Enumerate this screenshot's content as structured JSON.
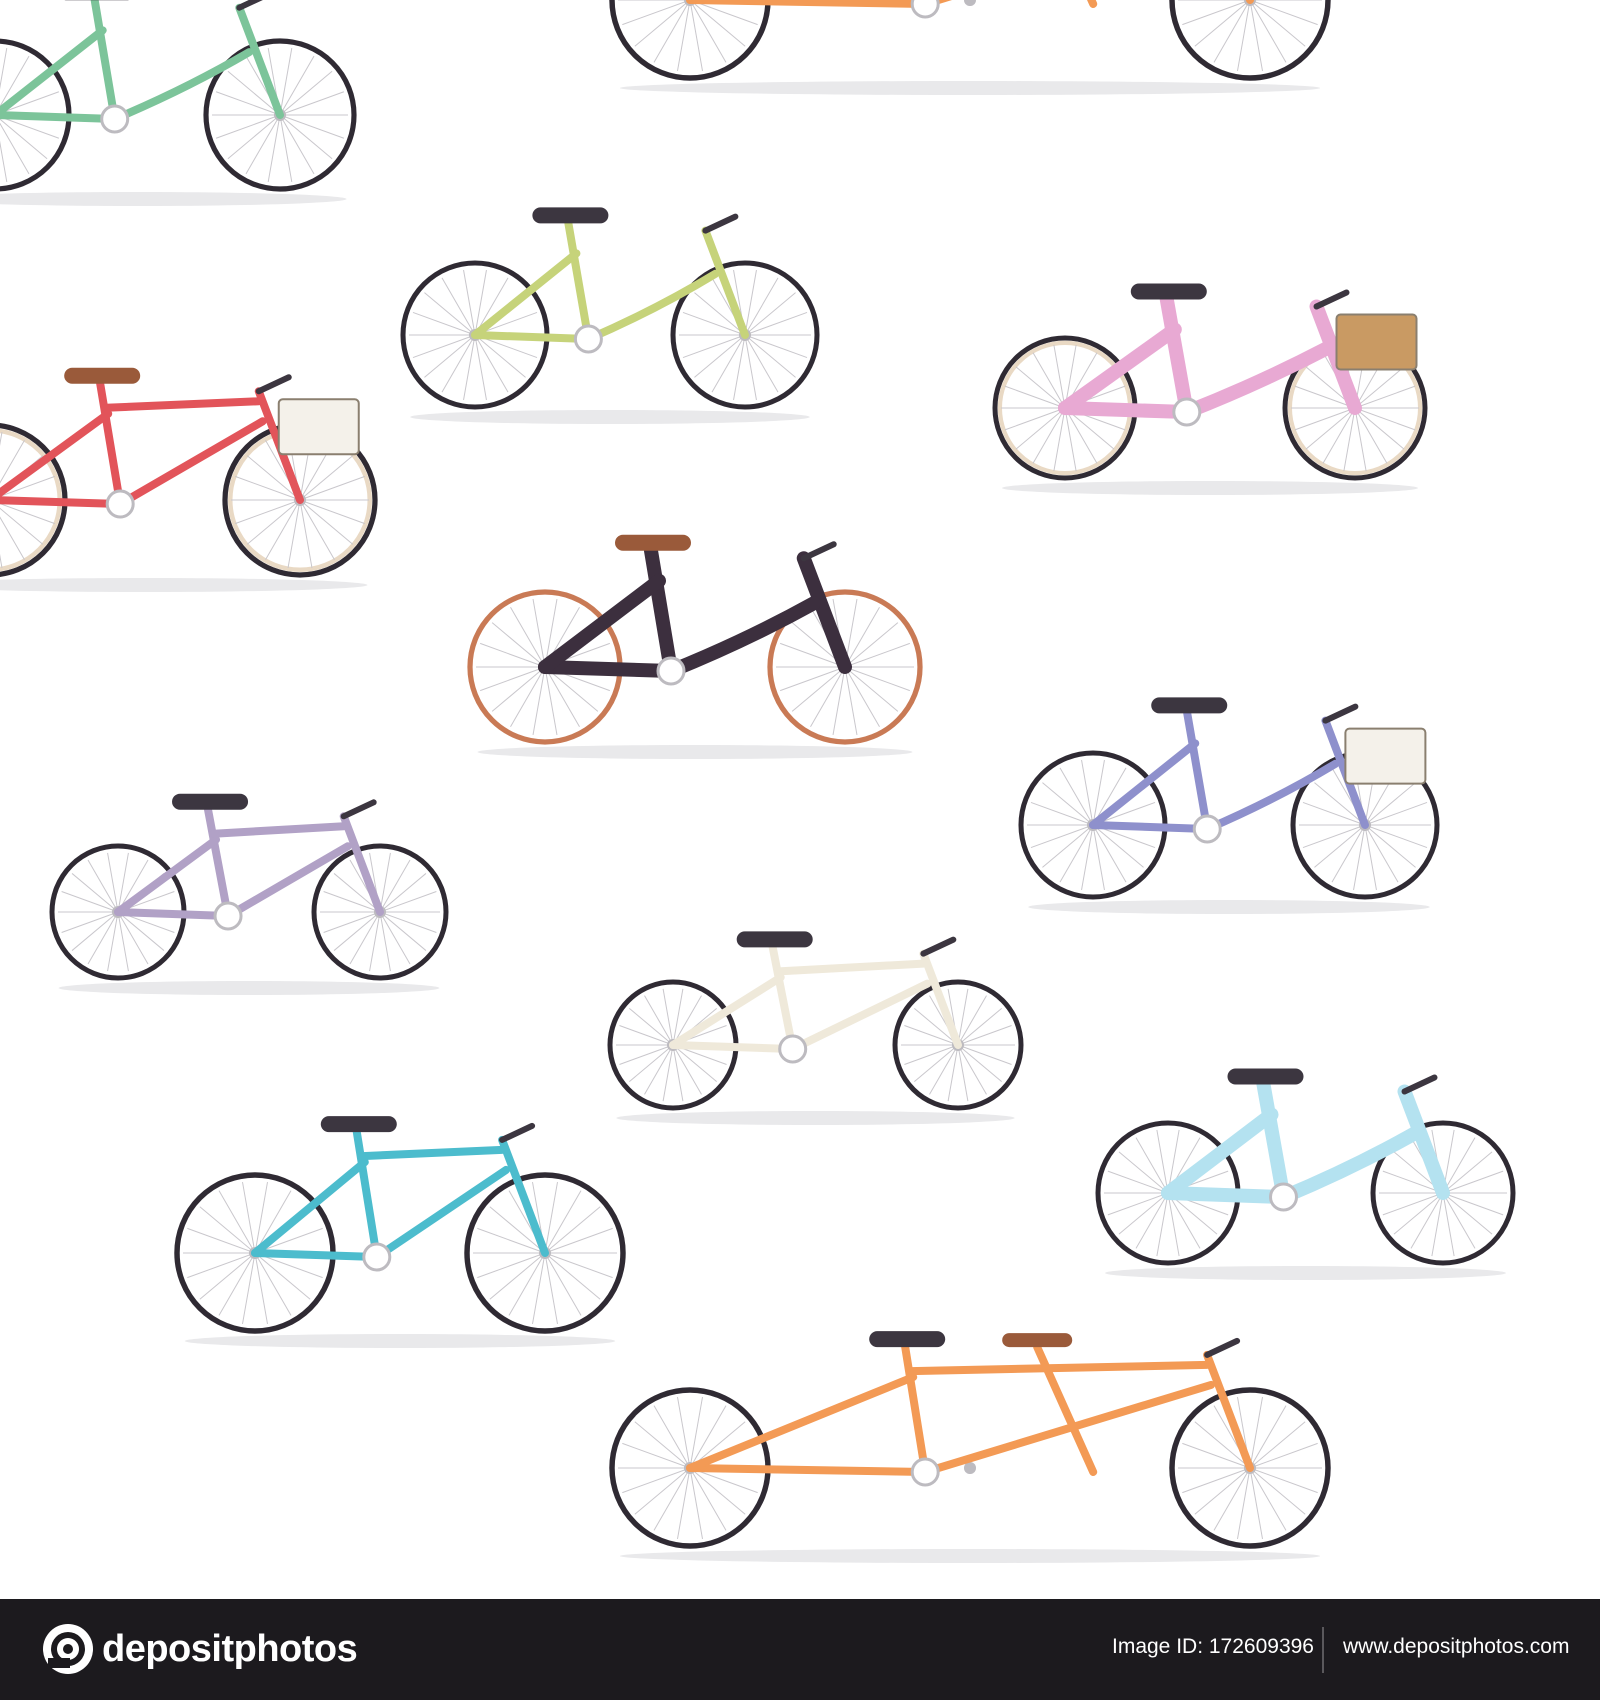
{
  "footer": {
    "brand": "depositphotos",
    "image_id": "Image ID: 172609396",
    "url": "www.depositphotos.com",
    "background": "#1c1a1e"
  },
  "watermark": {
    "text": "depositphotos"
  },
  "bikes": [
    {
      "id": "green-top-left",
      "frame": "#7cc49a",
      "kind": "step"
    },
    {
      "id": "orange-tandem-top",
      "frame": "#f39a55",
      "kind": "tandem"
    },
    {
      "id": "yellow-green",
      "frame": "#c6d37a",
      "kind": "step"
    },
    {
      "id": "pink-cruiser",
      "frame": "#e8a9d3",
      "kind": "cruiser"
    },
    {
      "id": "red-city",
      "frame": "#e2545a",
      "kind": "city"
    },
    {
      "id": "black-cruiser",
      "frame": "#3c2f3e",
      "kind": "cruiser"
    },
    {
      "id": "lilac-folding",
      "frame": "#b1a1c6",
      "kind": "folding"
    },
    {
      "id": "blue-city",
      "frame": "#8e90cc",
      "kind": "step"
    },
    {
      "id": "cream-folding",
      "frame": "#efe9da",
      "kind": "folding"
    },
    {
      "id": "teal-road",
      "frame": "#4cbccd",
      "kind": "road"
    },
    {
      "id": "light-blue-cruiser",
      "frame": "#b4e2f0",
      "kind": "cruiser"
    },
    {
      "id": "orange-tandem-bottom",
      "frame": "#f39a55",
      "kind": "tandem"
    }
  ]
}
